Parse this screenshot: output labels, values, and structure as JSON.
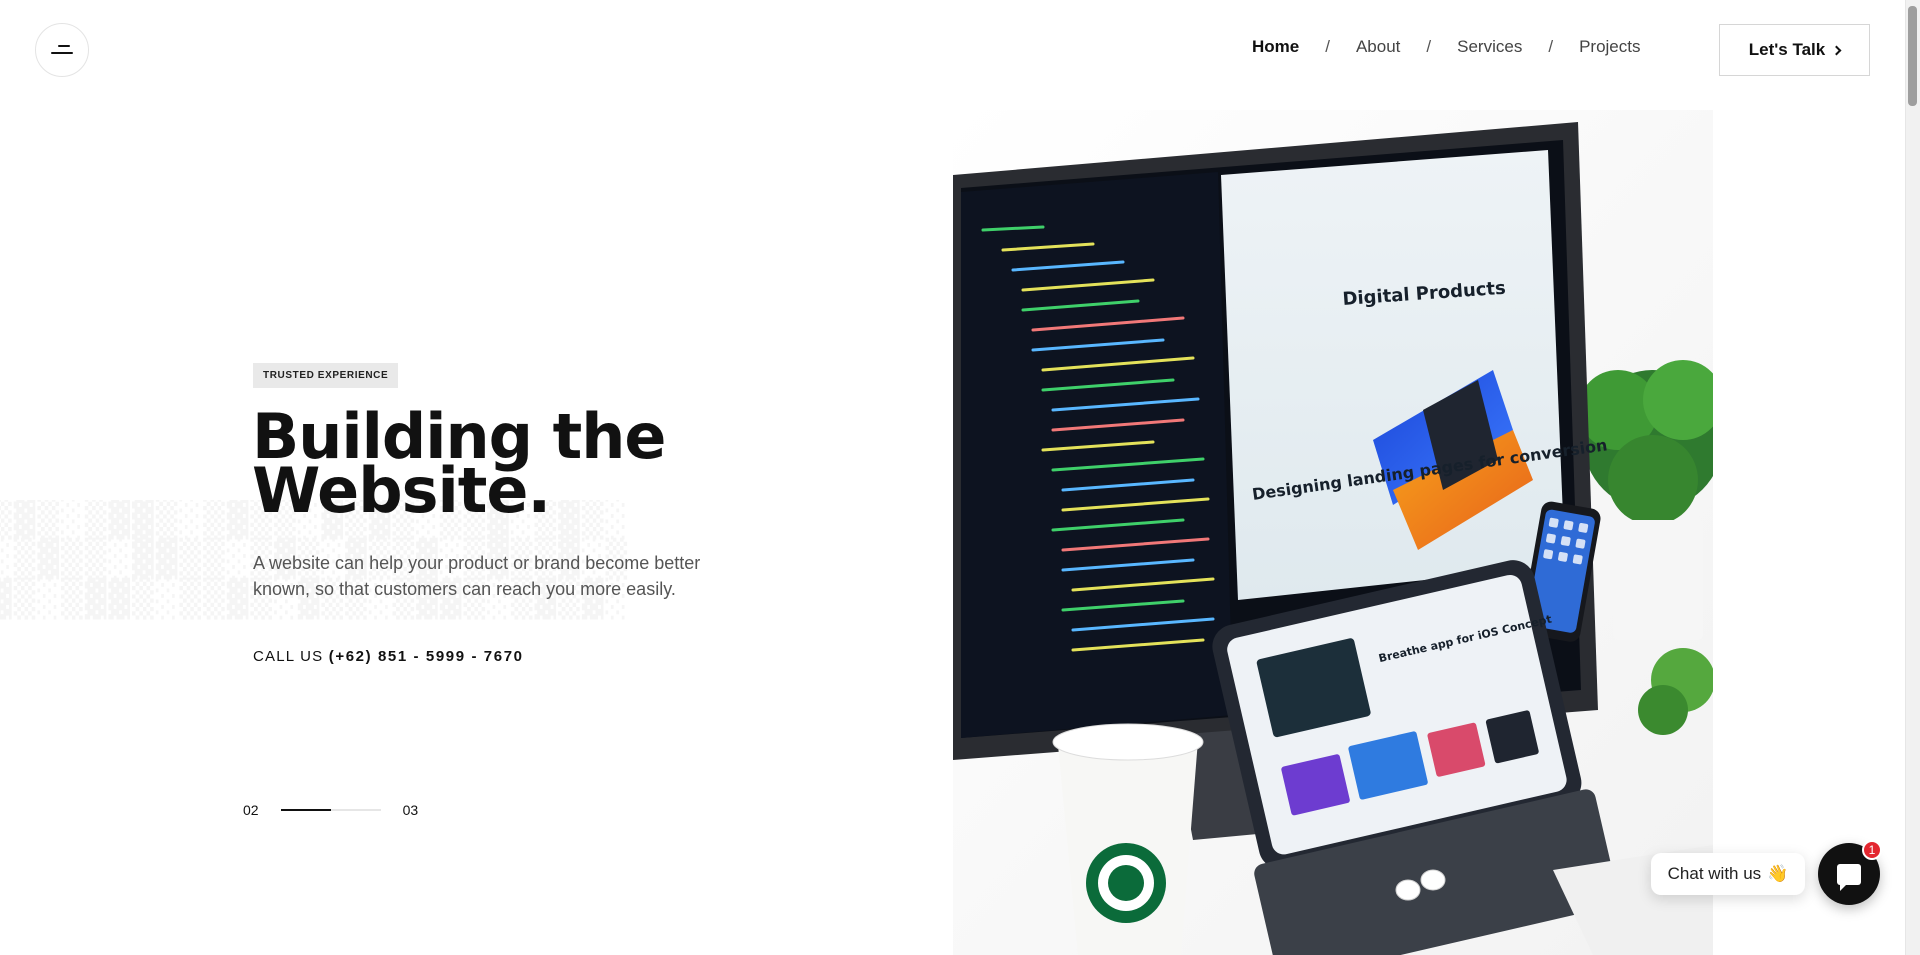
{
  "header": {
    "nav": [
      {
        "label": "Home",
        "active": true
      },
      {
        "label": "About",
        "active": false
      },
      {
        "label": "Services",
        "active": false
      },
      {
        "label": "Projects",
        "active": false
      }
    ],
    "separator": "/",
    "cta_label": "Let's Talk",
    "menu_icon": "menu-icon"
  },
  "hero": {
    "badge": "TRUSTED EXPERIENCE",
    "title_line1": "Building the",
    "title_line2": "Website.",
    "description": "A website can help your product or brand become better known, so that customers can reach you more easily.",
    "call_label": "CALL US",
    "phone": "(+62) 851 - 5999 - 7670",
    "slider": {
      "current": "02",
      "next": "03",
      "progress": 0.5
    }
  },
  "hero_image": {
    "screen_heading": "Digital Products",
    "screen_subheading": "Designing landing pages for conversion",
    "tablet_heading": "Breathe app for iOS Concept"
  },
  "chat": {
    "label": "Chat with us",
    "emoji": "👋",
    "badge_count": "1"
  },
  "colors": {
    "text": "#111111",
    "muted": "#555555",
    "badge_bg": "#e9e9e9",
    "notification": "#e3262f"
  }
}
